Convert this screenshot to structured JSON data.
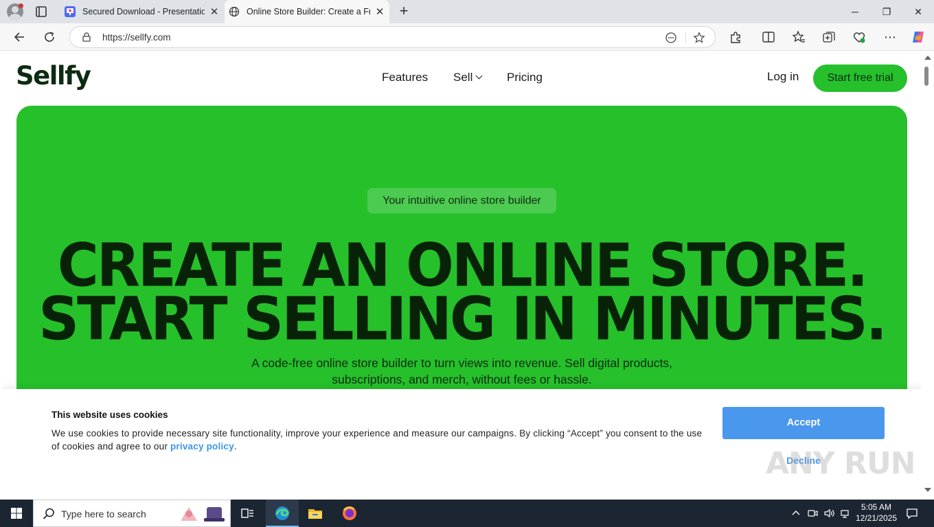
{
  "browser": {
    "tabs": [
      {
        "title": "Secured Download - Presentation",
        "favicon": "presentation-icon",
        "active": false
      },
      {
        "title": "Online Store Builder: Create a Free",
        "favicon": "globe-icon",
        "active": true
      }
    ],
    "address": {
      "url": "https://sellfy.com"
    }
  },
  "site": {
    "logo": "Sellfy",
    "nav": {
      "features": "Features",
      "sell": "Sell",
      "pricing": "Pricing"
    },
    "login": "Log in",
    "cta": "Start free trial",
    "hero": {
      "badge": "Your intuitive online store builder",
      "headline_line1": "CREATE AN ONLINE STORE.",
      "headline_line2": "START SELLING IN MINUTES.",
      "subtext": "A code-free online store builder to turn views into revenue. Sell digital products, subscriptions, and merch, without fees or hassle."
    },
    "colors": {
      "brand_green": "#26c02b",
      "dark_green": "#082208",
      "accept_blue": "#4a97ee"
    }
  },
  "cookie": {
    "title": "This website uses cookies",
    "text_before": "We use cookies to provide necessary site functionality, improve your experience and measure our campaigns. By clicking “Accept” you consent to the use of cookies and agree to our ",
    "link": "privacy policy",
    "text_after": ".",
    "accept": "Accept",
    "decline": "Decline"
  },
  "watermark": "ANY RUN",
  "taskbar": {
    "search_placeholder": "Type here to search",
    "time": "5:05 AM",
    "date": "12/21/2025"
  }
}
